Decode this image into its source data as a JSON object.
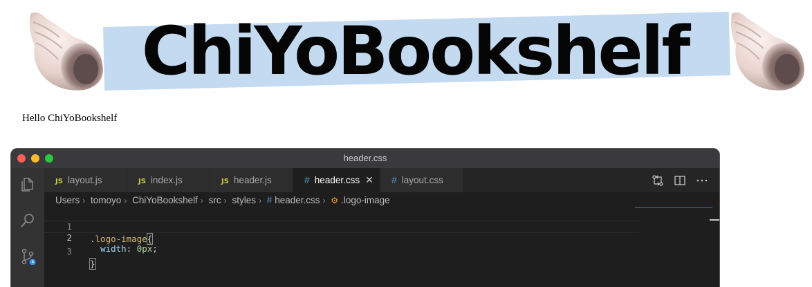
{
  "banner": {
    "title": "ChiYoBookshelf",
    "tape_color": "#c4daf1",
    "left_icon": "spiral-shell-icon",
    "right_icon": "spiral-shell-icon"
  },
  "page": {
    "hello_text": "Hello ChiYoBookshelf"
  },
  "editor": {
    "window_title": "header.css",
    "activity_icons": [
      "files-icon",
      "search-icon",
      "source-control-icon"
    ],
    "tabs": [
      {
        "icon": "JS",
        "label": "layout.js",
        "active": false
      },
      {
        "icon": "JS",
        "label": "index.js",
        "active": false
      },
      {
        "icon": "JS",
        "label": "header.js",
        "active": false
      },
      {
        "icon": "#",
        "label": "header.css",
        "active": true
      },
      {
        "icon": "#",
        "label": "layout.css",
        "active": false
      }
    ],
    "close_glyph": "✕",
    "actions": [
      "compare-changes-icon",
      "split-editor-icon",
      "more-actions-icon"
    ],
    "breadcrumb": [
      "Users",
      "tomoyo",
      "ChiYoBookshelf",
      "src",
      "styles",
      "header.css",
      ".logo-image"
    ],
    "lines": [
      {
        "num": "1",
        "selector": ".logo-image",
        "brace_open": "{"
      },
      {
        "num": "2",
        "indent": "  ",
        "property": "width",
        "colon": ": ",
        "value": "0px",
        "semi": ";"
      },
      {
        "num": "3",
        "brace_close": "}"
      }
    ],
    "colors": {
      "selector": "#d7ba7d",
      "property": "#9cdcfe",
      "number": "#b5cea8",
      "css_icon": "#519aba",
      "js_icon": "#cbcb41"
    }
  }
}
